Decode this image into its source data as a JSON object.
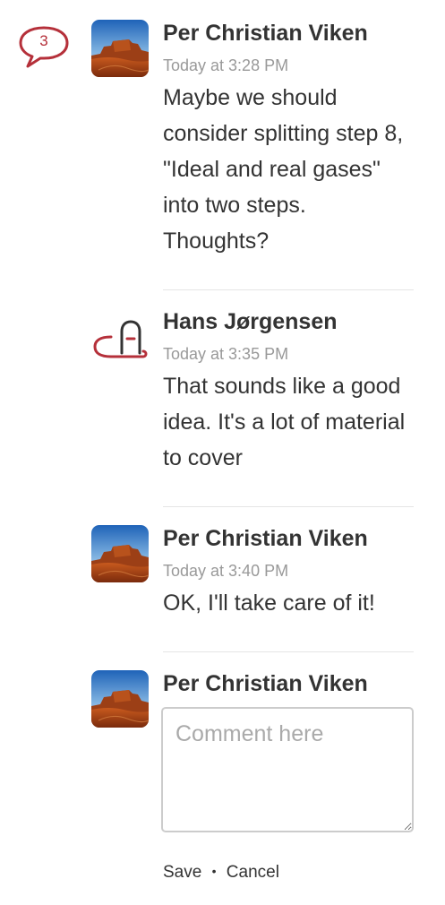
{
  "thread": {
    "comment_count": "3",
    "accent_color": "#b5303a"
  },
  "comments": [
    {
      "author": "Per Christian Viken",
      "timestamp": "Today at 3:28 PM",
      "text": "Maybe we should consider splitting step 8, \"Ideal and real gases\" into two steps. Thoughts?",
      "avatar_icon": "desert-landscape-photo"
    },
    {
      "author": "Hans Jørgensen",
      "timestamp": "Today at 3:35 PM",
      "text": "That sounds like a good idea. It's a lot of material to cover",
      "avatar_icon": "default-user-icon"
    },
    {
      "author": "Per Christian Viken",
      "timestamp": "Today at 3:40 PM",
      "text": "OK, I'll take care of it!",
      "avatar_icon": "desert-landscape-photo"
    }
  ],
  "new_comment": {
    "author": "Per Christian Viken",
    "placeholder": "Comment here",
    "value": "",
    "save_label": "Save",
    "separator": "•",
    "cancel_label": "Cancel"
  }
}
